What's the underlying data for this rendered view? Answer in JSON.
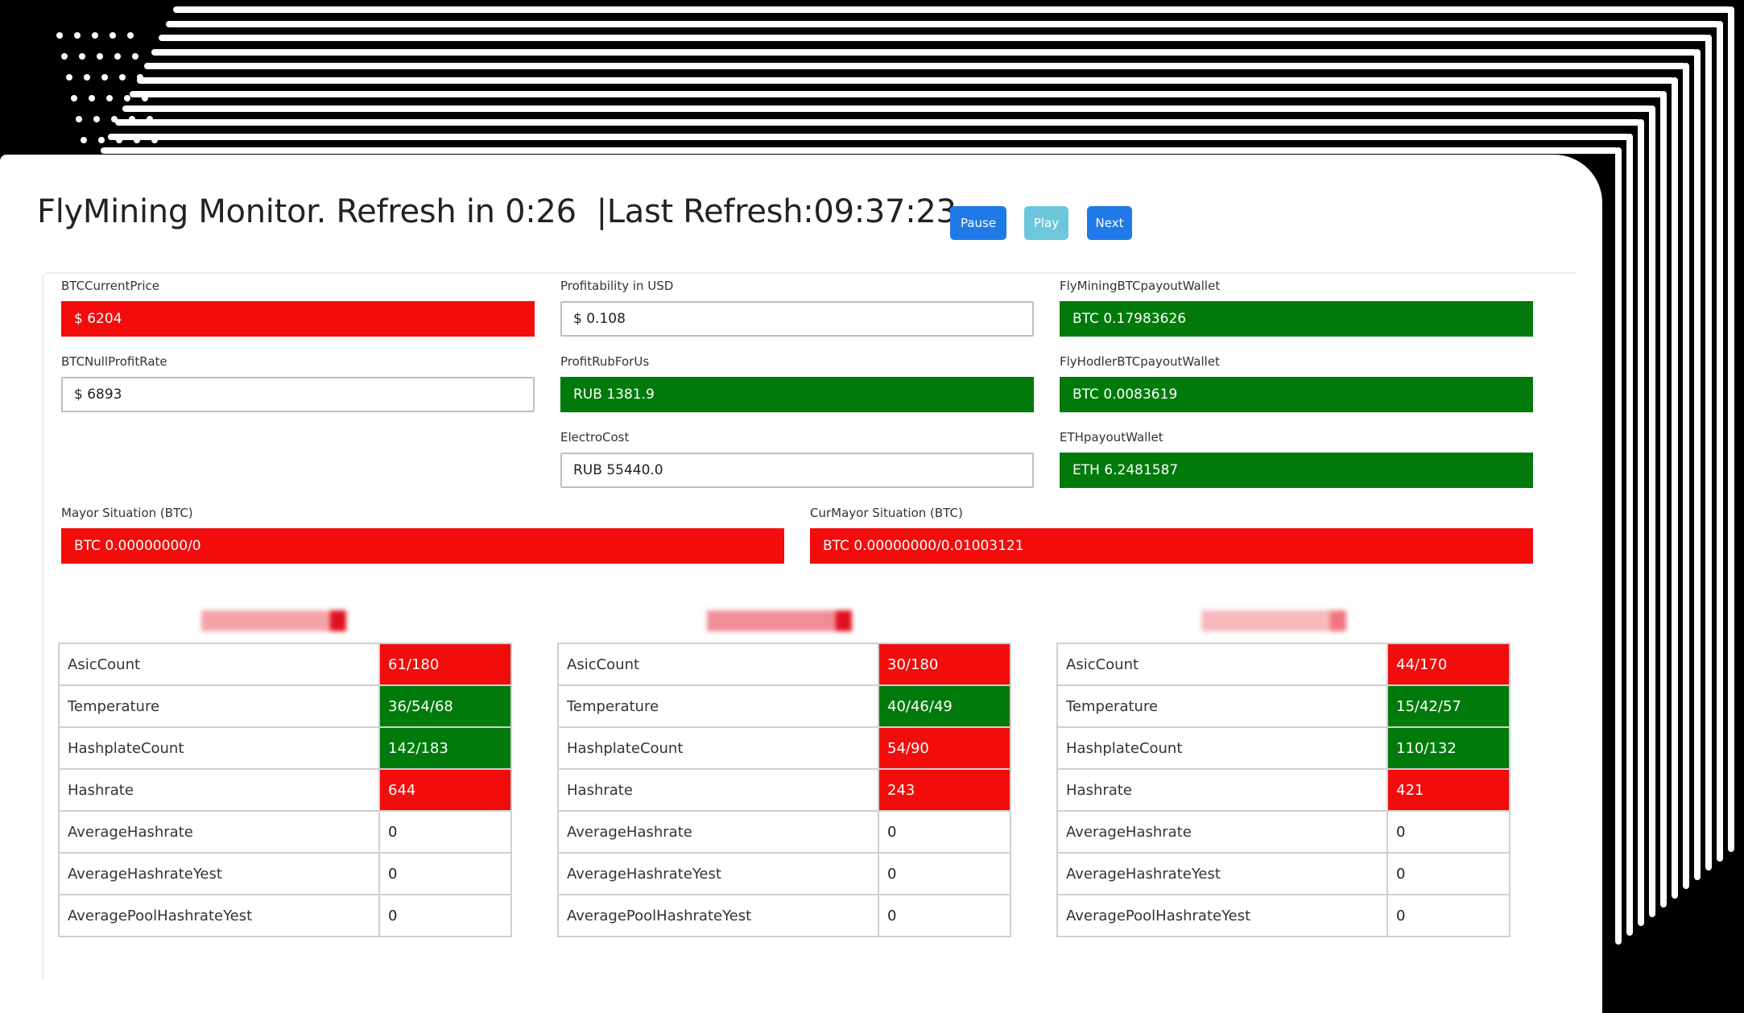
{
  "header": {
    "title": "FlyMining Monitor. Refresh in 0:26",
    "last_refresh": "|Last Refresh:09:37:23",
    "pause_label": "Pause",
    "play_label": "Play",
    "next_label": "Next"
  },
  "fields": {
    "btc_current_price": {
      "label": "BTCCurrentPrice",
      "value": "$ 6204",
      "status": "red"
    },
    "btc_null_profit_rate": {
      "label": "BTCNullProfitRate",
      "value": "$ 6893",
      "status": "plain"
    },
    "profitability_usd": {
      "label": "Profitability in USD",
      "value": "$ 0.108",
      "status": "plain"
    },
    "profit_rub_for_us": {
      "label": "ProfitRubForUs",
      "value": "RUB 1381.9",
      "status": "green"
    },
    "electro_cost": {
      "label": "ElectroCost",
      "value": "RUB 55440.0",
      "status": "plain"
    },
    "flymining_btc_payout_wallet": {
      "label": "FlyMiningBTCpayoutWallet",
      "value": "BTC 0.17983626",
      "status": "green"
    },
    "flyhodler_btc_payout_wallet": {
      "label": "FlyHodlerBTCpayoutWallet",
      "value": "BTC 0.0083619",
      "status": "green"
    },
    "eth_payout_wallet": {
      "label": "ETHpayoutWallet",
      "value": "ETH 6.2481587",
      "status": "green"
    },
    "mayor_situation": {
      "label": "Mayor Situation (BTC)",
      "value": "BTC 0.00000000/0",
      "status": "red"
    },
    "cur_mayor_situation": {
      "label": "CurMayor Situation (BTC)",
      "value": "BTC 0.00000000/0.01003121",
      "status": "red"
    }
  },
  "sites": [
    {
      "rows": [
        {
          "key": "AsicCount",
          "value": "61/180",
          "status": "red"
        },
        {
          "key": "Temperature",
          "value": "36/54/68",
          "status": "green"
        },
        {
          "key": "HashplateCount",
          "value": "142/183",
          "status": "green"
        },
        {
          "key": "Hashrate",
          "value": "644",
          "status": "red"
        },
        {
          "key": "AverageHashrate",
          "value": "0",
          "status": "plain"
        },
        {
          "key": "AverageHashrateYest",
          "value": "0",
          "status": "plain"
        },
        {
          "key": "AveragePoolHashrateYest",
          "value": "0",
          "status": "plain"
        }
      ]
    },
    {
      "rows": [
        {
          "key": "AsicCount",
          "value": "30/180",
          "status": "red"
        },
        {
          "key": "Temperature",
          "value": "40/46/49",
          "status": "green"
        },
        {
          "key": "HashplateCount",
          "value": "54/90",
          "status": "red"
        },
        {
          "key": "Hashrate",
          "value": "243",
          "status": "red"
        },
        {
          "key": "AverageHashrate",
          "value": "0",
          "status": "plain"
        },
        {
          "key": "AverageHashrateYest",
          "value": "0",
          "status": "plain"
        },
        {
          "key": "AveragePoolHashrateYest",
          "value": "0",
          "status": "plain"
        }
      ]
    },
    {
      "rows": [
        {
          "key": "AsicCount",
          "value": "44/170",
          "status": "red"
        },
        {
          "key": "Temperature",
          "value": "15/42/57",
          "status": "green"
        },
        {
          "key": "HashplateCount",
          "value": "110/132",
          "status": "green"
        },
        {
          "key": "Hashrate",
          "value": "421",
          "status": "red"
        },
        {
          "key": "AverageHashrate",
          "value": "0",
          "status": "plain"
        },
        {
          "key": "AverageHashrateYest",
          "value": "0",
          "status": "plain"
        },
        {
          "key": "AveragePoolHashrateYest",
          "value": "0",
          "status": "plain"
        }
      ]
    }
  ],
  "colors": {
    "red": "#f20c0c",
    "green": "#007a0a",
    "primary_button": "#1f7ae8",
    "info_button": "#6ec6dc"
  }
}
